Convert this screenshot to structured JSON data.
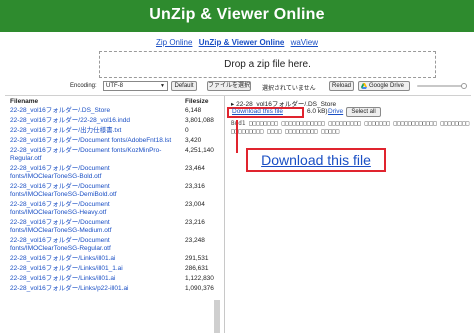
{
  "header": {
    "title": "UnZip & Viewer Online",
    "bg_color": "#2e8b2e"
  },
  "nav": {
    "items": [
      "Zip Online",
      "UnZip & Viewer Online",
      "waView"
    ],
    "active_index": 1
  },
  "dropzone": {
    "label": "Drop a zip file here."
  },
  "toolbar": {
    "encoding_label": "Encoding:",
    "encoding_value": "UTF-8",
    "default_button": "Default",
    "choose_file_button": "ファイルを選択",
    "no_file_text": "選択されていません",
    "reload_button": "Reload",
    "google_drive_button": "Google Drive"
  },
  "table": {
    "col_filename": "Filename",
    "col_filesize": "Filesize",
    "rows": [
      {
        "name": "22-28_vol16フォルダー/.DS_Store",
        "size": "6,148",
        "lines": 1
      },
      {
        "name": "22-28_vol16フォルダー/22-28_vol16.indd",
        "size": "3,801,088",
        "lines": 1
      },
      {
        "name": "22-28_vol16フォルダー/出力仕様書.txt",
        "size": "0",
        "lines": 1
      },
      {
        "name": "22-28_vol16フォルダー/Document fonts/AdobeFnt18.lst",
        "size": "3,420",
        "lines": 1
      },
      {
        "name": "22-28_vol16フォルダー/Document fonts/KozMinPro-Regular.otf",
        "size": "4,251,140",
        "lines": 2
      },
      {
        "name": "22-28_vol16フォルダー/Document fonts/IMOClearToneSG-Bold.otf",
        "size": "23,464",
        "lines": 2
      },
      {
        "name": "22-28_vol16フォルダー/Document fonts/IMOClearToneSG-DemiBold.otf",
        "size": "23,316",
        "lines": 2
      },
      {
        "name": "22-28_vol16フォルダー/Document fonts/IMOClearToneSG-Heavy.otf",
        "size": "23,004",
        "lines": 2
      },
      {
        "name": "22-28_vol16フォルダー/Document fonts/IMOClearToneSG-Medium.otf",
        "size": "23,216",
        "lines": 2
      },
      {
        "name": "22-28_vol16フォルダー/Document fonts/IMOClearToneSG-Regular.otf",
        "size": "23,248",
        "lines": 2
      },
      {
        "name": "22-28_vol16フォルダー/Links/ill01.ai",
        "size": "291,531",
        "lines": 1
      },
      {
        "name": "22-28_vol16フォルダー/Links/ill01_1.ai",
        "size": "286,631",
        "lines": 1
      },
      {
        "name": "22-28_vol16フォルダー/Links/ill01.ai",
        "size": "1,122,830",
        "lines": 1
      },
      {
        "name": "22-28_vol16フォルダー/Links/p22-ill01.ai",
        "size": "1,090,376",
        "lines": 1
      }
    ]
  },
  "viewer": {
    "breadcrumb": "22-28_vol16フォルダー/.DS_Store",
    "download_link": "Download this file",
    "size_text": "6.0 kB)",
    "drive_link": "Drive",
    "select_all_button": "Select all",
    "preview_text": "Bud1 □□□□□□□□ □□□□□□□□□□□□ □□□□□□□□□ □□□□□□□ □□□□□□□□□□□□ □□□□□□□□ □□□□□□□□□ □□□□ □□□□□□□□□ □□□□□"
  },
  "callout": {
    "label": "Download this file",
    "color": "#e0242e"
  }
}
